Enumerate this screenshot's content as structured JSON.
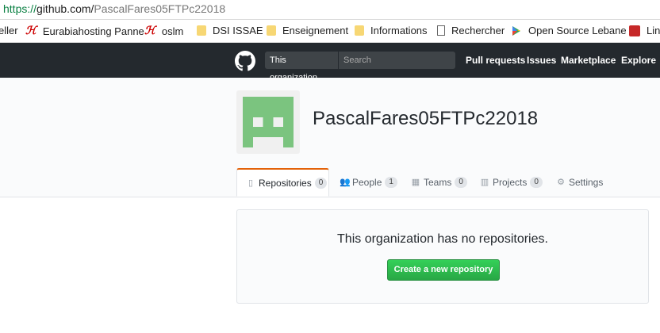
{
  "address_bar": {
    "scheme": "https://",
    "host": "github.com/",
    "path": "PascalFares05FTPc22018"
  },
  "bookmarks": [
    {
      "label": "eller",
      "icon": "none"
    },
    {
      "label": "Eurabiahosting Panne",
      "icon": "hosting-logo-icon"
    },
    {
      "label": "oslm",
      "icon": "hosting-logo-icon"
    },
    {
      "label": "DSI ISSAE",
      "icon": "folder-icon"
    },
    {
      "label": "Enseignement",
      "icon": "folder-icon"
    },
    {
      "label": "Informations",
      "icon": "folder-icon"
    },
    {
      "label": "Rechercher",
      "icon": "document-icon"
    },
    {
      "label": "Open Source Lebane",
      "icon": "play-store-icon"
    },
    {
      "label": "Lin",
      "icon": "linked-logo-icon"
    }
  ],
  "header": {
    "scope_label": "This organization",
    "search_placeholder": "Search",
    "nav": [
      "Pull requests",
      "Issues",
      "Marketplace",
      "Explore"
    ]
  },
  "org": {
    "name": "PascalFares05FTPc22018"
  },
  "tabs": [
    {
      "label": "Repositories",
      "count": "0",
      "icon": "repo-icon",
      "selected": true
    },
    {
      "label": "People",
      "count": "1",
      "icon": "people-icon"
    },
    {
      "label": "Teams",
      "count": "0",
      "icon": "teams-icon"
    },
    {
      "label": "Projects",
      "count": "0",
      "icon": "projects-icon"
    },
    {
      "label": "Settings",
      "icon": "gear-icon"
    }
  ],
  "blankslate": {
    "message": "This organization has no repositories.",
    "button": "Create a new repository"
  },
  "colors": {
    "header_bg": "#24292e",
    "tab_accent": "#e36209",
    "button_green": "#28a745",
    "avatar_green": "#7bc47f"
  }
}
